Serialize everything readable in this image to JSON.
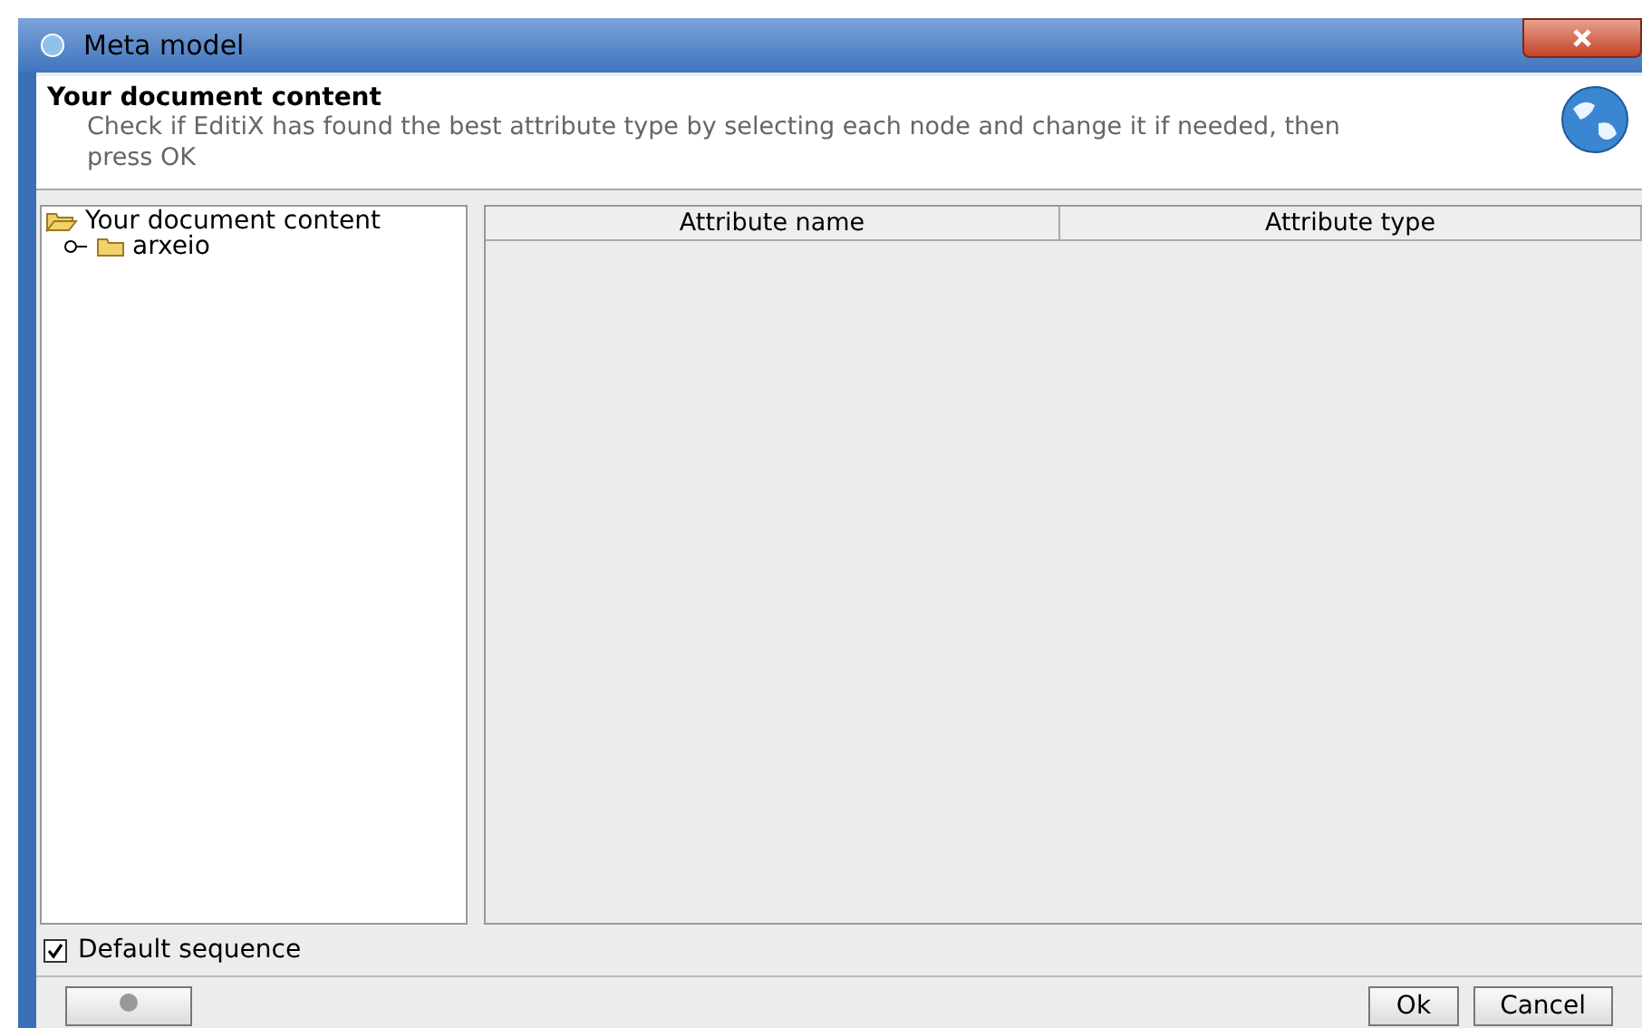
{
  "window": {
    "title": "Meta model"
  },
  "header": {
    "title": "Your document content",
    "description": "Check if EditiX has found the best attribute type by selecting each node and change it if needed, then press OK"
  },
  "tree": {
    "label": "Your document content",
    "expanded": true,
    "children": [
      {
        "label": "arxeio",
        "expanded": false
      }
    ]
  },
  "table": {
    "columns": [
      "Attribute name",
      "Attribute type"
    ]
  },
  "default_sequence": {
    "label": "Default sequence",
    "checked": true
  },
  "buttons": [
    "Ok",
    "Cancel"
  ]
}
